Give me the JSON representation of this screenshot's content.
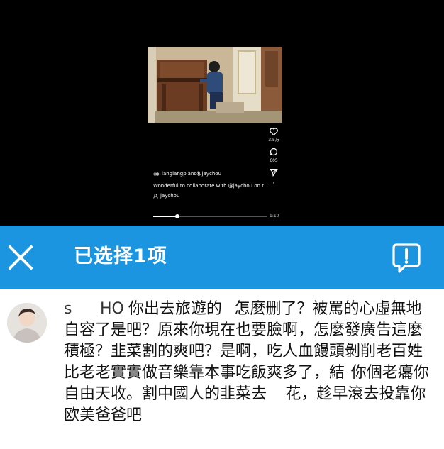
{
  "video": {
    "handles": "langlangpiano和jaychou",
    "caption": "Wonderful to collaborate with @jaychou on t…",
    "tag": "jaychou",
    "likes": "3.5万",
    "comments": "605",
    "duration": "1:10",
    "progress": 0.21
  },
  "select_bar": {
    "title": "已选择1项",
    "accent": "#1b95e0"
  },
  "comment": {
    "username": "s         HO",
    "text": "你出去旅遊的    怎麼删了？被罵的心虛無地自容了是吧？原來你現在也要臉啊，怎麼發廣告這麼積極？韭菜割的爽吧？是啊，吃人血饅頭剝削老百姓比老老實實做音樂靠本事吃飯爽多了，結  你個老癟你自由天收。割中國人的韭菜去      花，趁早滾去投靠你欧美爸爸吧"
  },
  "icons": {
    "like": "heart-icon",
    "comment": "comment-bubble-icon",
    "share": "send-icon",
    "close": "close-icon",
    "report": "report-icon"
  }
}
